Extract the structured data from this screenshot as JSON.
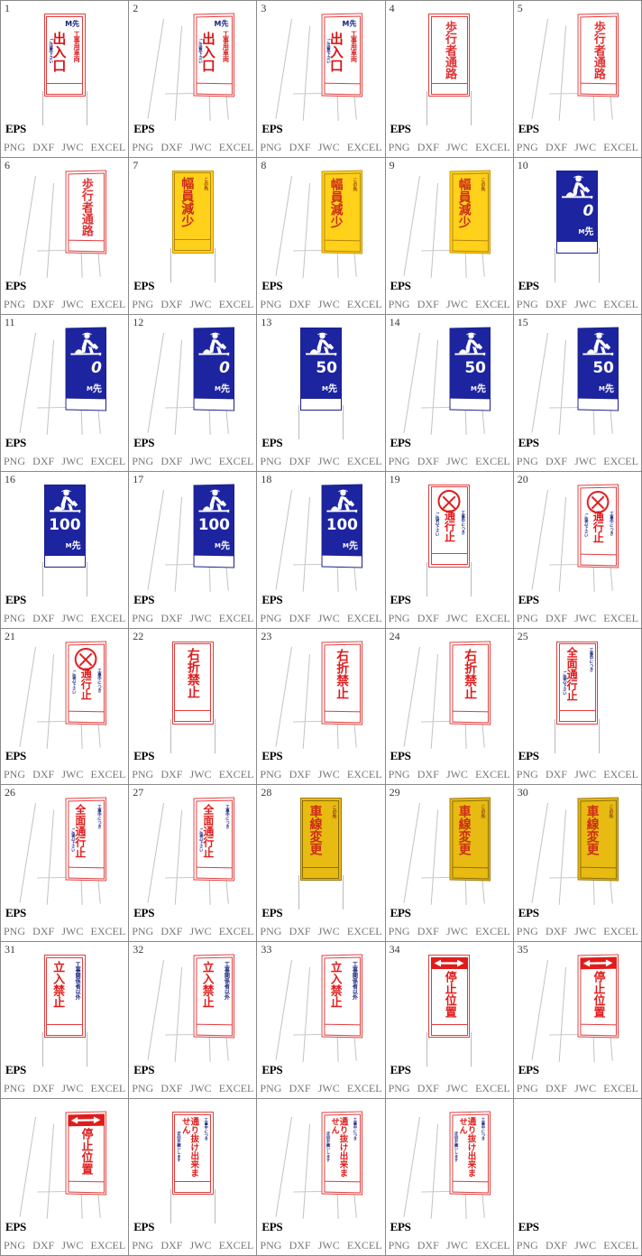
{
  "formats": {
    "eps": "EPS",
    "list": [
      "PNG",
      "DXF",
      "JWC",
      "EXCEL"
    ]
  },
  "colors": {
    "red": "#e01b1b",
    "blue": "#1d24a0",
    "navy": "#16237e",
    "yellow": "#ffd11a",
    "gold": "#e8bb12",
    "grid": "#8a8a8a",
    "number": "#3a3a3a",
    "format_text": "#777777"
  },
  "strings": {
    "deiriguchi": "出入口",
    "koujiyou_sharyou": "工事用車両",
    "gochuui": "ご注意下さい",
    "m_saki": "M先",
    "hokousha_tsuuro": "歩行者通路",
    "fukuin_genshou": "幅員減少",
    "konosaki": "この先",
    "tsuukoudome": "通行止",
    "koujichu_nitsuki": "工事中につき",
    "gokyouryoku": "ご協力下さい",
    "usetsu_kinshi": "右折禁止",
    "zenmen_tsuukoudome": "全面通行止",
    "shasen_henkou": "車線変更",
    "tachiiri_kinshi": "立入禁止",
    "koujikankeisha_igai": "工事関係者以外",
    "teishi_ichi": "停止位置",
    "toorinuke": "通り抜け出来ません",
    "ukai_onegai": "迂回お願いします",
    "saki": "先"
  },
  "cells": [
    {
      "n": "1",
      "type": "deiriguchi",
      "stand": "post",
      "distance": ""
    },
    {
      "n": "2",
      "type": "deiriguchi",
      "stand": "aframe",
      "distance": ""
    },
    {
      "n": "3",
      "type": "deiriguchi",
      "stand": "aframe",
      "distance": ""
    },
    {
      "n": "4",
      "type": "hokousha",
      "stand": "post",
      "distance": ""
    },
    {
      "n": "5",
      "type": "hokousha",
      "stand": "aframe",
      "distance": ""
    },
    {
      "n": "6",
      "type": "hokousha",
      "stand": "aframe",
      "distance": ""
    },
    {
      "n": "7",
      "type": "fukuin",
      "stand": "post",
      "distance": ""
    },
    {
      "n": "8",
      "type": "fukuin",
      "stand": "aframe",
      "distance": ""
    },
    {
      "n": "9",
      "type": "fukuin",
      "stand": "aframe",
      "distance": ""
    },
    {
      "n": "10",
      "type": "worker",
      "stand": "post",
      "distance": "0"
    },
    {
      "n": "11",
      "type": "worker",
      "stand": "aframe",
      "distance": "0"
    },
    {
      "n": "12",
      "type": "worker",
      "stand": "aframe",
      "distance": "0"
    },
    {
      "n": "13",
      "type": "worker",
      "stand": "post",
      "distance": "50"
    },
    {
      "n": "14",
      "type": "worker",
      "stand": "aframe",
      "distance": "50"
    },
    {
      "n": "15",
      "type": "worker",
      "stand": "aframe",
      "distance": "50"
    },
    {
      "n": "16",
      "type": "worker",
      "stand": "post",
      "distance": "100"
    },
    {
      "n": "17",
      "type": "worker",
      "stand": "aframe",
      "distance": "100"
    },
    {
      "n": "18",
      "type": "worker",
      "stand": "aframe",
      "distance": "100"
    },
    {
      "n": "19",
      "type": "tsuuko",
      "stand": "post",
      "distance": ""
    },
    {
      "n": "20",
      "type": "tsuuko",
      "stand": "aframe",
      "distance": ""
    },
    {
      "n": "21",
      "type": "tsuuko",
      "stand": "aframe",
      "distance": ""
    },
    {
      "n": "22",
      "type": "usetsu",
      "stand": "post",
      "distance": ""
    },
    {
      "n": "23",
      "type": "usetsu",
      "stand": "aframe",
      "distance": ""
    },
    {
      "n": "24",
      "type": "usetsu",
      "stand": "aframe",
      "distance": ""
    },
    {
      "n": "25",
      "type": "zenmen",
      "stand": "post",
      "distance": ""
    },
    {
      "n": "26",
      "type": "zenmen",
      "stand": "aframe",
      "distance": ""
    },
    {
      "n": "27",
      "type": "zenmen",
      "stand": "aframe",
      "distance": ""
    },
    {
      "n": "28",
      "type": "shasen",
      "stand": "post",
      "distance": ""
    },
    {
      "n": "29",
      "type": "shasen",
      "stand": "aframe",
      "distance": ""
    },
    {
      "n": "30",
      "type": "shasen",
      "stand": "aframe",
      "distance": ""
    },
    {
      "n": "31",
      "type": "tachiiri",
      "stand": "post",
      "distance": ""
    },
    {
      "n": "32",
      "type": "tachiiri",
      "stand": "aframe",
      "distance": ""
    },
    {
      "n": "33",
      "type": "tachiiri",
      "stand": "aframe",
      "distance": ""
    },
    {
      "n": "34",
      "type": "teishi",
      "stand": "post",
      "distance": ""
    },
    {
      "n": "35",
      "type": "teishi",
      "stand": "aframe",
      "distance": ""
    },
    {
      "n": "",
      "type": "teishi",
      "stand": "aframe",
      "distance": ""
    },
    {
      "n": "",
      "type": "toorinuke",
      "stand": "post",
      "distance": ""
    },
    {
      "n": "",
      "type": "toorinuke",
      "stand": "aframe",
      "distance": ""
    },
    {
      "n": "",
      "type": "toorinuke",
      "stand": "aframe",
      "distance": ""
    },
    {
      "n": "",
      "type": "empty",
      "stand": "none",
      "distance": ""
    }
  ]
}
